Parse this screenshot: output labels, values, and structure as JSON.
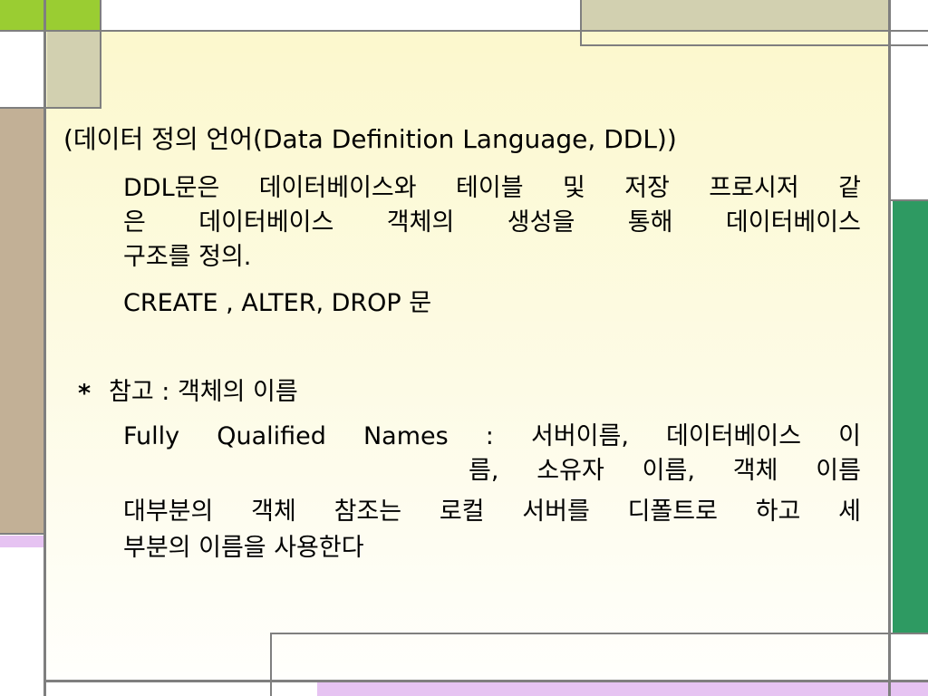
{
  "colors": {
    "slide_background": "#fcf8cd",
    "lime_green": "#9acd32",
    "khaki": "#d2d0b0",
    "tan": "#c2b096",
    "teal_green": "#2e9a62",
    "lavender": "#e6c3f2",
    "gray_line": "#7f7f7f"
  },
  "title": "(데이터 정의 언어(Data Definition Language, DDL))",
  "ddl": {
    "line1": [
      "DDL문은",
      "데이터베이스와",
      "테이블",
      "및",
      "저장",
      "프로시저",
      "같"
    ],
    "line2": [
      "은",
      "데이터베이스",
      "객체의",
      "생성을",
      "통해",
      "데이터베이스"
    ],
    "line3": "구조를 정의.",
    "statements": "CREATE , ALTER, DROP 문"
  },
  "note": {
    "bullet": "*",
    "heading": "참고 : 객체의 이름",
    "line1": [
      "Fully",
      "Qualified",
      "Names",
      ":",
      "서버이름,",
      "데이터베이스",
      "이"
    ],
    "line2": [
      "름,",
      "소유자",
      "이름,",
      "객체",
      "이름"
    ],
    "line3": [
      "대부분의",
      "객체",
      "참조는",
      "로컬",
      "서버를",
      "디폴트로",
      "하고",
      "세"
    ],
    "line4": "부분의 이름을 사용한다"
  }
}
